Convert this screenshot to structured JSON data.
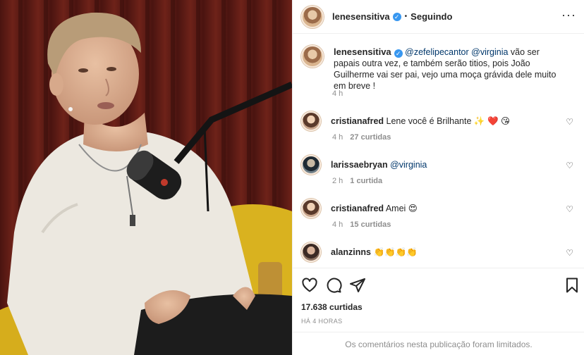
{
  "header": {
    "username": "lenesensitiva",
    "verified_mark": "✓",
    "separator": "•",
    "follow_status": "Seguindo",
    "more_icon": "···"
  },
  "caption": {
    "username": "lenesensitiva",
    "mention1": "@zefelipecantor",
    "mention2": "@virginia",
    "text": " vão ser papais outra vez, e também serão titios, pois João Guilherme vai ser pai, vejo uma moça grávida dele muito em breve !",
    "time": "4 h"
  },
  "comments": [
    {
      "username": "cristianafred",
      "text": "Lene você é Brilhante ✨ ❤️ 😘",
      "time": "4 h",
      "likes": "27 curtidas"
    },
    {
      "username": "larissaebryan",
      "text": "@virginia",
      "time": "2 h",
      "likes": "1 curtida"
    },
    {
      "username": "cristianafred",
      "text": "Amei 😍",
      "time": "4 h",
      "likes": "15 curtidas"
    },
    {
      "username": "alanzinns",
      "text": "👏👏👏👏",
      "time": "",
      "likes": ""
    }
  ],
  "icons": {
    "like": "heart-icon",
    "comment": "comment-icon",
    "share": "share-icon",
    "save": "bookmark-icon",
    "comment_like": "♡"
  },
  "post": {
    "likes": "17.638 curtidas",
    "time_ago": "HÁ 4 HORAS",
    "comments_limited": "Os comentários nesta publicação foram limitados."
  }
}
